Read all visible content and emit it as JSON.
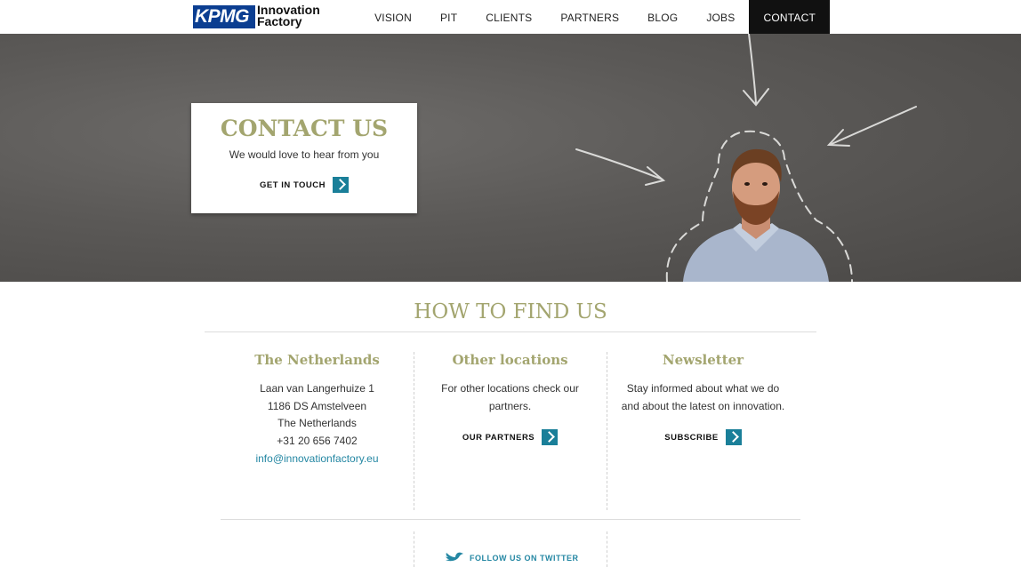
{
  "header": {
    "logo_kpmg": "KPMG",
    "logo_line1": "Innovation",
    "logo_line2": "Factory",
    "nav": [
      {
        "label": "VISION"
      },
      {
        "label": "PIT"
      },
      {
        "label": "CLIENTS"
      },
      {
        "label": "PARTNERS"
      },
      {
        "label": "BLOG"
      },
      {
        "label": "JOBS"
      },
      {
        "label": "CONTACT"
      }
    ]
  },
  "hero": {
    "title": "CONTACT US",
    "subtitle": "We would love to hear from you",
    "cta_label": "GET IN TOUCH"
  },
  "find": {
    "title": "HOW TO FIND US",
    "netherlands": {
      "title": "The Netherlands",
      "street": "Laan van Langerhuize 1",
      "postal": "1186 DS Amstelveen",
      "country": "The Netherlands",
      "phone": "+31 20 656 7402",
      "email": "info@innovationfactory.eu"
    },
    "other": {
      "title": "Other locations",
      "text": "For other locations check our partners.",
      "cta_label": "OUR PARTNERS"
    },
    "newsletter": {
      "title": "Newsletter",
      "text": "Stay informed about what we do and about the latest on innovation.",
      "cta_label": "SUBSCRIBE"
    }
  },
  "footer": {
    "twitter_label": "FOLLOW US ON TWITTER"
  },
  "colors": {
    "accent": "#a3a56f",
    "button": "#1a7f99",
    "link": "#2487a3",
    "nav_active_bg": "#111111"
  }
}
